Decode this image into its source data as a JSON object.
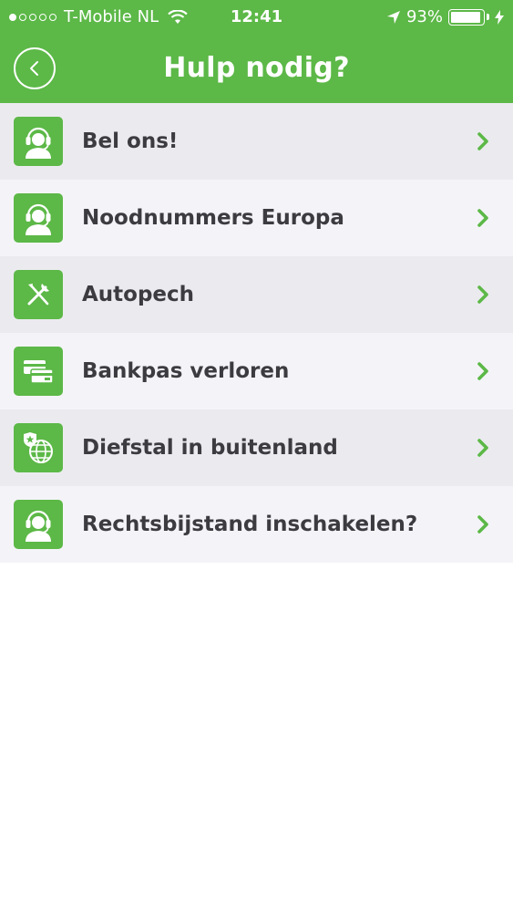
{
  "status_bar": {
    "carrier": "T-Mobile NL",
    "time": "12:41",
    "battery_percent": "93%",
    "battery_level": 0.93,
    "signal_dots_filled": 1,
    "signal_dots_total": 5
  },
  "header": {
    "title": "Hulp nodig?",
    "back_icon": "chevron-left-icon",
    "color": "#5cb847"
  },
  "menu": {
    "items": [
      {
        "label": "Bel ons!",
        "icon": "headset-agent-icon"
      },
      {
        "label": "Noodnummers Europa",
        "icon": "headset-agent-icon"
      },
      {
        "label": "Autopech",
        "icon": "tools-icon"
      },
      {
        "label": "Bankpas verloren",
        "icon": "bank-cards-icon"
      },
      {
        "label": "Diefstal in buitenland",
        "icon": "globe-shield-icon"
      },
      {
        "label": "Rechtsbijstand inschakelen?",
        "icon": "headset-agent-icon"
      }
    ]
  }
}
